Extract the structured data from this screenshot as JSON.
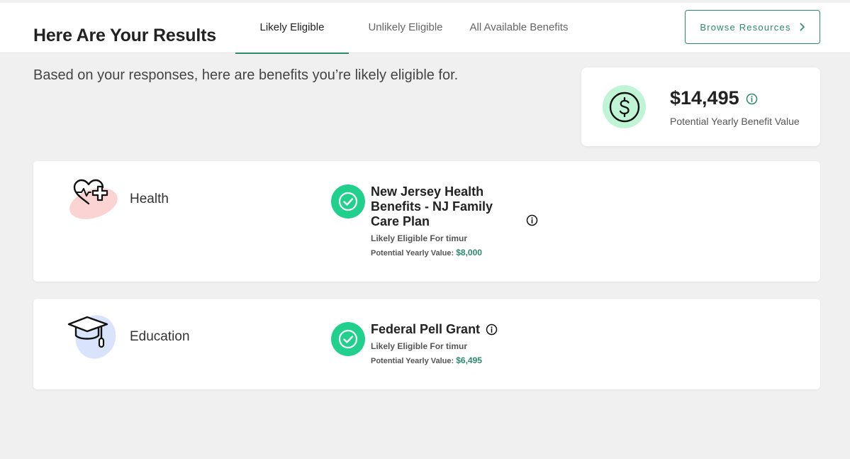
{
  "header": {
    "title": "Here Are Your Results",
    "tabs": [
      {
        "label": "Likely Eligible",
        "active": true
      },
      {
        "label": "Unlikely Eligible",
        "active": false
      },
      {
        "label": "All Available Benefits",
        "active": false
      }
    ],
    "browse_label": "Browse Resources"
  },
  "intro": "Based on your responses, here are benefits you’re likely eligible for.",
  "summary": {
    "amount": "$14,495",
    "label": "Potential Yearly Benefit Value"
  },
  "categories": [
    {
      "name": "Health",
      "benefit": {
        "title": "New Jersey Health Benefits - NJ Family Care Plan",
        "eligibility": "Likely Eligible For timur",
        "value_label": "Potential Yearly Value:",
        "value": "$8,000"
      }
    },
    {
      "name": "Education",
      "benefit": {
        "title": "Federal Pell Grant",
        "eligibility": "Likely Eligible For timur",
        "value_label": "Potential Yearly Value:",
        "value": "$6,495"
      }
    }
  ],
  "colors": {
    "accent": "#2c8a6e",
    "check_green": "#22d08e",
    "dollar_bg": "#bff5d6",
    "health_blob": "#fbd3d3",
    "education_blob": "#d9e3fb"
  },
  "icons": [
    "chevron-right-icon",
    "dollar-icon",
    "info-icon",
    "heart-plus-icon",
    "graduation-cap-icon",
    "check-icon"
  ]
}
